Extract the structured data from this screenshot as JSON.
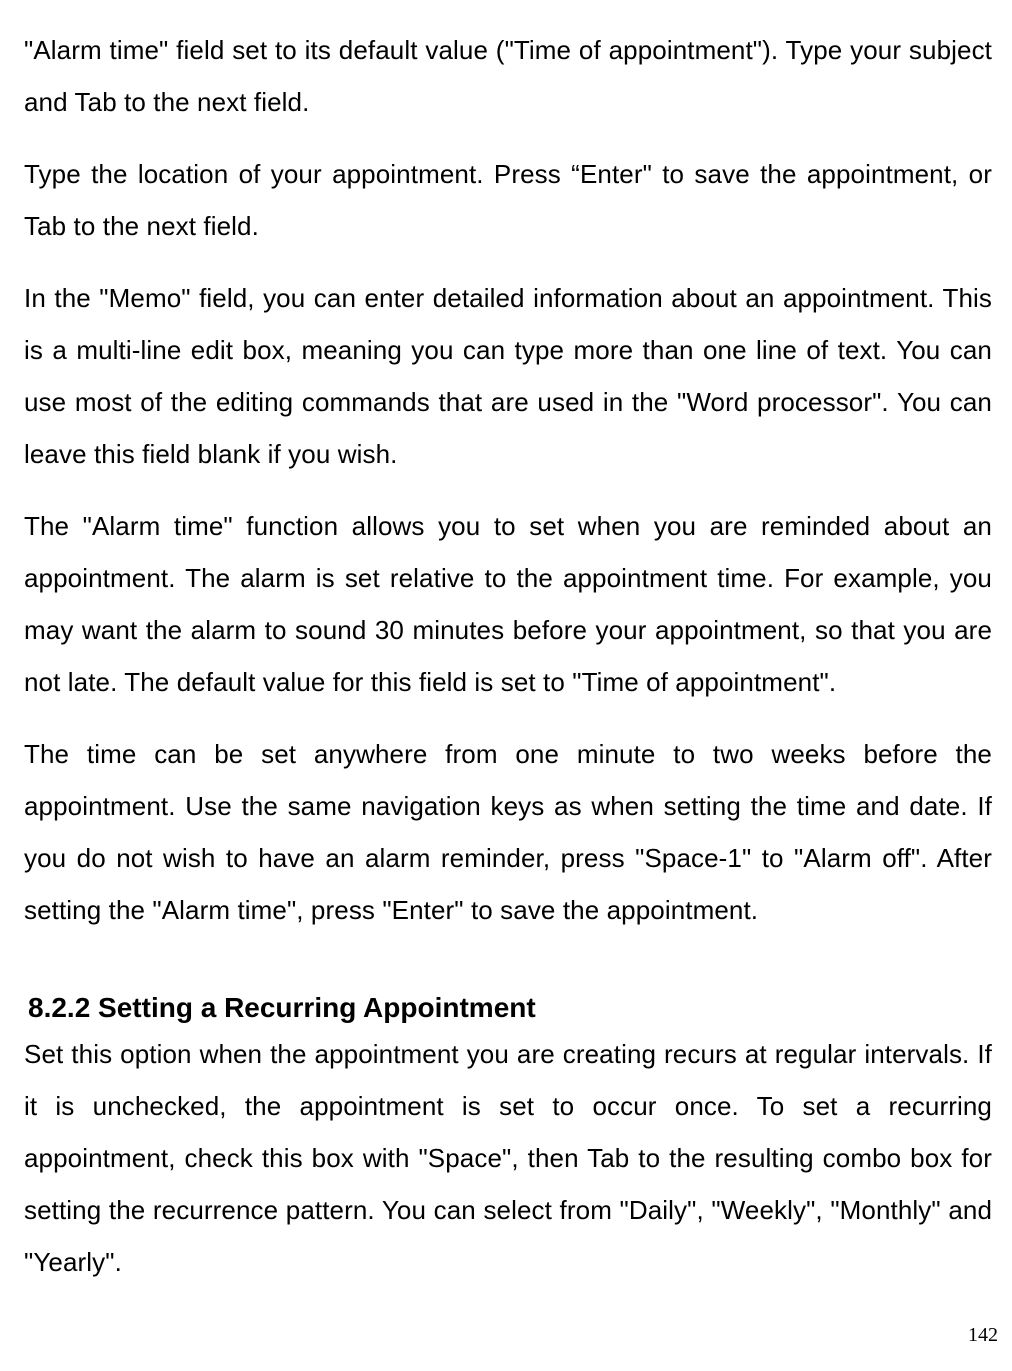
{
  "paragraphs": {
    "p1": "\"Alarm time\" field set to its default value (\"Time of appointment\"). Type your subject and Tab to the next field.",
    "p2": "Type the location of your appointment. Press “Enter\" to save the appointment, or Tab to the next field.",
    "p3": "In the \"Memo\" field, you can enter detailed information about an appointment. This is a multi-line edit box, meaning you can type more than one line of text. You can use most of the editing commands that are used in the \"Word processor\". You can leave this field blank if you wish.",
    "p4": "The \"Alarm time\" function allows you to set when you are reminded about an appointment. The alarm is set relative to the appointment time. For example, you may want the alarm to sound 30 minutes before your appointment, so that you are not late. The default value for this field is set to \"Time of appointment\".",
    "p5": "The time can be set anywhere from one minute to two weeks before the appointment. Use the same navigation keys as when setting the time and date. If you do not wish to have an alarm reminder, press \"Space-1\" to \"Alarm off\". After setting the \"Alarm time\", press \"Enter\" to save the appointment."
  },
  "heading": "8.2.2 Setting a Recurring Appointment",
  "afterHeading": {
    "p6": "Set this option when the appointment you are creating recurs at regular intervals. If it is unchecked, the appointment is set to occur once. To set a recurring appointment, check this box with \"Space\", then Tab to the resulting combo box for setting the recurrence pattern. You can select from \"Daily\", \"Weekly\", \"Monthly\" and \"Yearly\"."
  },
  "pageNumber": "142"
}
